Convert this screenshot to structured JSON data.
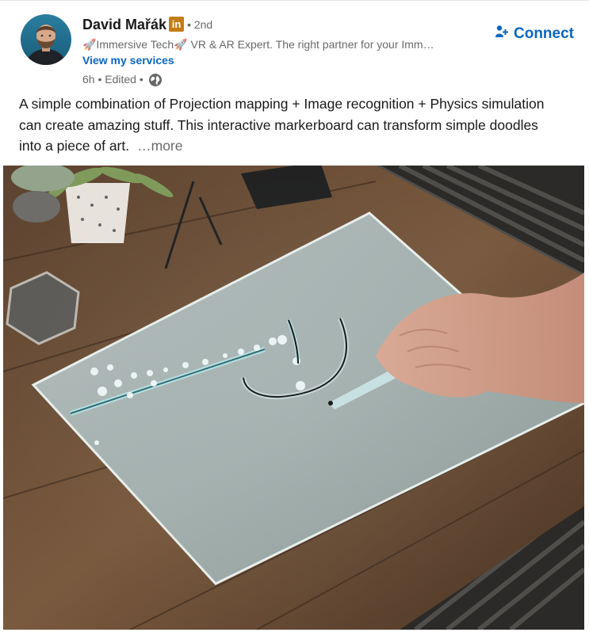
{
  "post": {
    "author": {
      "name": "David Mařák",
      "badge": "in",
      "degree": "• 2nd",
      "headline": "🚀Immersive Tech🚀 VR & AR Expert. The right partner for your Imm…",
      "services_link": "View my services",
      "timestamp": "6h • Edited •",
      "visibility_icon": "globe-icon"
    },
    "connect_label": "Connect",
    "connect_icon": "add-person-icon",
    "commentary": {
      "text": "A simple combination of Projection mapping + Image recognition + Physics simulation can create amazing stuff. This interactive markerboard can transform simple doodles into a piece of art.",
      "more": "…more"
    },
    "media": {
      "type": "video-thumbnail",
      "icon": "interactive-markerboard-image"
    }
  },
  "colors": {
    "link_blue": "#0a66c2",
    "badge_gold": "#c37d16",
    "text_primary": "rgba(0,0,0,0.9)",
    "text_secondary": "rgba(0,0,0,0.6)"
  }
}
